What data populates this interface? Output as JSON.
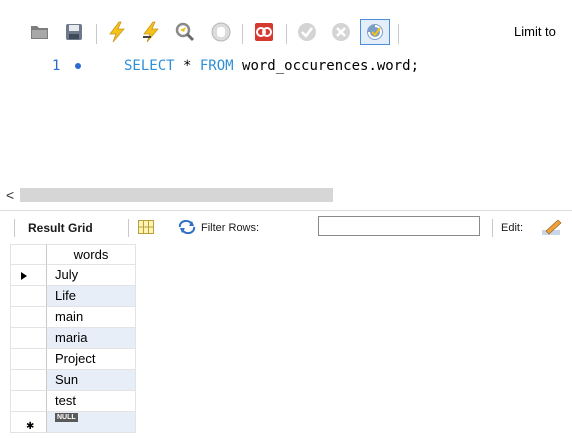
{
  "toolbar": {
    "icons": [
      "open-folder-icon",
      "save-icon",
      "execute-icon",
      "execute-current-icon",
      "explain-icon",
      "stop-icon",
      "toggle-error-icon",
      "commit-icon",
      "rollback-icon",
      "autocommit-icon"
    ],
    "limit_label": "Limit to"
  },
  "editor": {
    "line_number": "1",
    "keyword_select": "SELECT",
    "star": " * ",
    "keyword_from": "FROM",
    "rest": " word_occurences.word;"
  },
  "results": {
    "tab_label": "Result Grid",
    "filter_label": "Filter Rows:",
    "filter_value": "",
    "edit_label": "Edit:",
    "column_header": "words",
    "rows": [
      "July",
      "Life",
      "main",
      "maria",
      "Project",
      "Sun",
      "test"
    ],
    "null_label": "NULL"
  },
  "colors": {
    "keyword": "#2f8fd6",
    "line_number": "#2b6bd1",
    "alt_row": "#e8eef8"
  }
}
